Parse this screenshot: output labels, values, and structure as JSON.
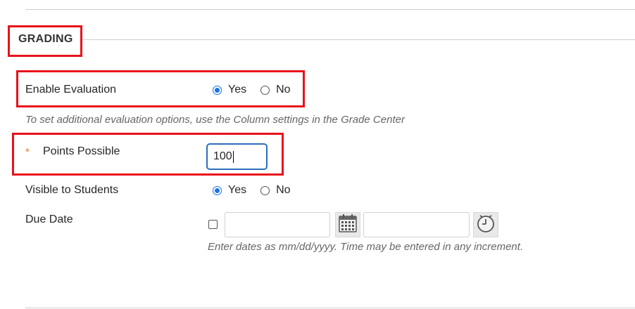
{
  "section": {
    "title": "GRADING"
  },
  "evaluation": {
    "label": "Enable Evaluation",
    "options": [
      "Yes",
      "No"
    ],
    "selected": "Yes",
    "hint": "To set additional evaluation options, use the Column settings in the Grade Center"
  },
  "points": {
    "required_mark": "*",
    "label": "Points Possible",
    "value": "100"
  },
  "visible": {
    "label": "Visible to Students",
    "options": [
      "Yes",
      "No"
    ],
    "selected": "Yes"
  },
  "due_date": {
    "label": "Due Date",
    "checked": false,
    "date_value": "",
    "time_value": "",
    "calendar_icon": "calendar-icon",
    "clock_icon": "clock-icon",
    "hint": "Enter dates as mm/dd/yyyy. Time may be entered in any increment."
  },
  "colors": {
    "highlight_box": "#e8121a",
    "accent": "#1a73e8",
    "required": "#e67e22",
    "focus_border": "#2a6ebb"
  }
}
